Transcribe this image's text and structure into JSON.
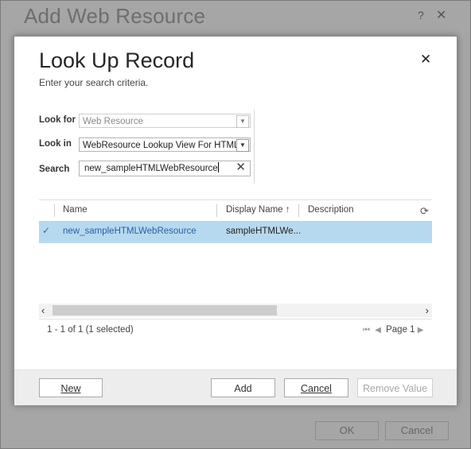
{
  "background_window": {
    "title": "Add Web Resource",
    "help_icon": "?",
    "close_icon": "✕",
    "ok_label": "OK",
    "cancel_label": "Cancel"
  },
  "dialog": {
    "title": "Look Up Record",
    "subtitle": "Enter your search criteria.",
    "close_icon": "✕"
  },
  "form": {
    "look_for_label": "Look for",
    "look_for_value": "Web Resource",
    "look_in_label": "Look in",
    "look_in_value": "WebResource Lookup View For HTML",
    "search_label": "Search",
    "search_value": "new_sampleHTMLWebResource"
  },
  "grid": {
    "columns": [
      {
        "label": "Name"
      },
      {
        "label": "Display Name",
        "sort_icon": "↑"
      },
      {
        "label": "Description"
      }
    ],
    "rows": [
      {
        "selected": true,
        "name": "new_sampleHTMLWebResource",
        "display_name": "sampleHTMLWe..."
      }
    ],
    "refresh_icon": "refresh-icon"
  },
  "pager": {
    "count_text": "1 - 1 of 1 (1 selected)",
    "page_label": "Page 1"
  },
  "footer": {
    "new_label": "New",
    "add_label": "Add",
    "cancel_label": "Cancel",
    "remove_label": "Remove Value"
  },
  "colors": {
    "selected_row": "#b7d9ef",
    "link": "#2a5fa3",
    "overlay": "#a6a6a6"
  }
}
